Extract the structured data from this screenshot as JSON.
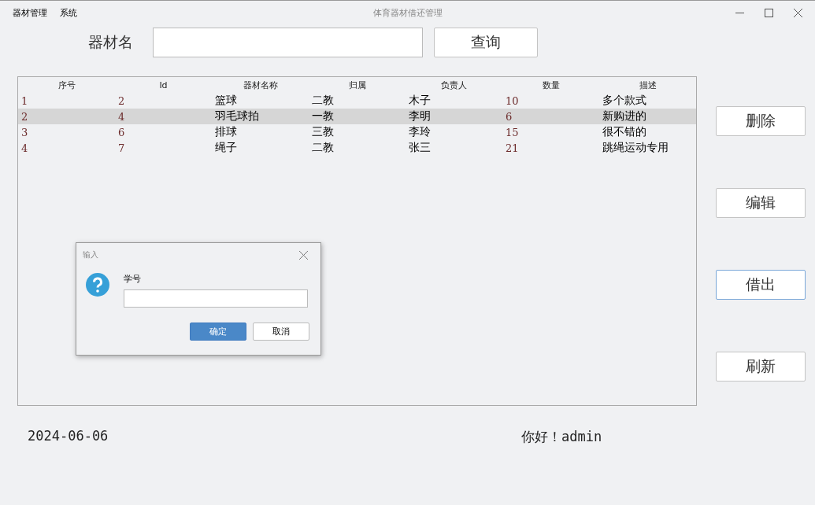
{
  "window": {
    "title": "体育器材借还管理"
  },
  "menu": [
    "器材管理",
    "系统"
  ],
  "search": {
    "label": "器材名",
    "button": "查询"
  },
  "table": {
    "columns": [
      {
        "label": "序号",
        "kind": "number"
      },
      {
        "label": "Id",
        "kind": "number"
      },
      {
        "label": "器材名称",
        "kind": "text"
      },
      {
        "label": "归属",
        "kind": "text"
      },
      {
        "label": "负责人",
        "kind": "text"
      },
      {
        "label": "数量",
        "kind": "number"
      },
      {
        "label": "描述",
        "kind": "text"
      }
    ],
    "rows": [
      {
        "selected": false,
        "cells": [
          "1",
          "2",
          "篮球",
          "二教",
          "木子",
          "10",
          "多个款式"
        ]
      },
      {
        "selected": true,
        "cells": [
          "2",
          "4",
          "羽毛球拍",
          "一教",
          "李明",
          "6",
          "新购进的"
        ]
      },
      {
        "selected": false,
        "cells": [
          "3",
          "6",
          "排球",
          "三教",
          "李玲",
          "15",
          "很不错的"
        ]
      },
      {
        "selected": false,
        "cells": [
          "4",
          "7",
          "绳子",
          "二教",
          "张三",
          "21",
          "跳绳运动专用"
        ]
      }
    ]
  },
  "actions": [
    {
      "label": "删除",
      "focused": false
    },
    {
      "label": "编辑",
      "focused": false
    },
    {
      "label": "借出",
      "focused": true
    },
    {
      "label": "刷新",
      "focused": false
    }
  ],
  "status": {
    "date": "2024-06-06",
    "greeting": "你好！admin"
  },
  "dialog": {
    "title": "输入",
    "label": "学号",
    "ok": "确定",
    "cancel": "取消"
  }
}
